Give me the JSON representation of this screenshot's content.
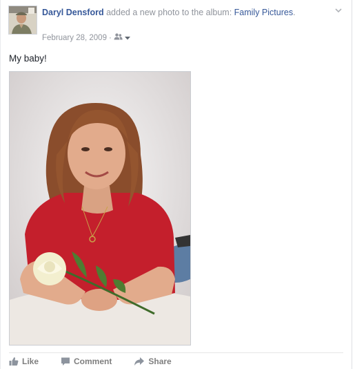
{
  "post": {
    "author": "Daryl Densford",
    "action_text": " added a new photo to the album: ",
    "album": "Family Pictures",
    "album_suffix": ".",
    "date": "February 28, 2009",
    "separator": " · ",
    "privacy_icon": "friends-icon",
    "menu_icon": "chevron-down-icon",
    "caption": "My baby!"
  },
  "actions": {
    "like_label": "Like",
    "comment_label": "Comment",
    "share_label": "Share"
  },
  "colors": {
    "link": "#365899",
    "meta": "#90949c",
    "action": "#7f7f7f"
  }
}
